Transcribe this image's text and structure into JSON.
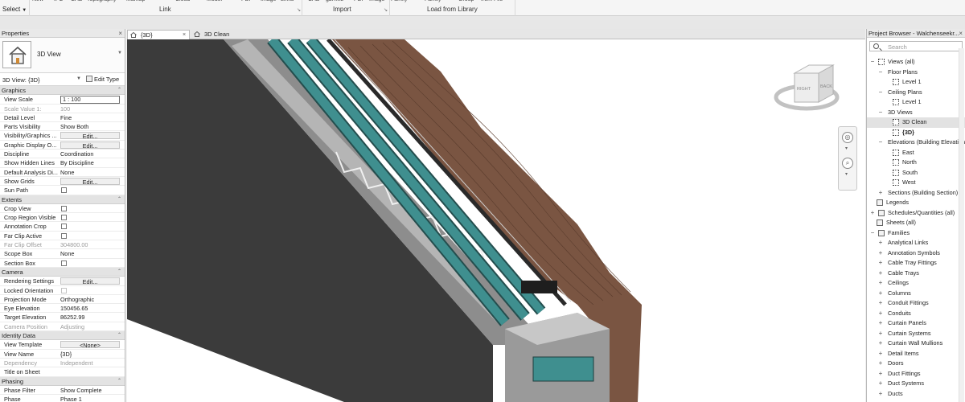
{
  "ribbon": {
    "cut_labels": [
      "New",
      "IFC",
      "CAD",
      "Topography",
      "Markup",
      "Cloud",
      "Model",
      "PDF",
      "Image",
      "Links",
      "CAD",
      "gbXML",
      "PDF",
      "Image",
      "Family",
      "Family",
      "Group",
      "from File"
    ],
    "select_label": "Select",
    "groups": {
      "link": "Link",
      "import": "Import",
      "load_from_library": "Load from Library"
    }
  },
  "properties": {
    "title": "Properties",
    "type_name": "3D View",
    "instance_selector": "3D View: {3D}",
    "edit_type": "Edit Type",
    "sections": [
      {
        "name": "Graphics",
        "rows": [
          {
            "k": "View Scale",
            "v": "1 : 100",
            "kind": "input"
          },
          {
            "k": "Scale Value    1:",
            "v": "100",
            "kind": "dis"
          },
          {
            "k": "Detail Level",
            "v": "Fine"
          },
          {
            "k": "Parts Visibility",
            "v": "Show Both"
          },
          {
            "k": "Visibility/Graphics ...",
            "v": "Edit...",
            "kind": "btn"
          },
          {
            "k": "Graphic Display O...",
            "v": "Edit...",
            "kind": "btn"
          },
          {
            "k": "Discipline",
            "v": "Coordination"
          },
          {
            "k": "Show Hidden Lines",
            "v": "By Discipline"
          },
          {
            "k": "Default Analysis Di...",
            "v": "None"
          },
          {
            "k": "Show Grids",
            "v": "Edit...",
            "kind": "btn"
          },
          {
            "k": "Sun Path",
            "v": "",
            "kind": "cb"
          }
        ]
      },
      {
        "name": "Extents",
        "rows": [
          {
            "k": "Crop View",
            "v": "",
            "kind": "cb"
          },
          {
            "k": "Crop Region Visible",
            "v": "",
            "kind": "cb"
          },
          {
            "k": "Annotation Crop",
            "v": "",
            "kind": "cb"
          },
          {
            "k": "Far Clip Active",
            "v": "",
            "kind": "cb"
          },
          {
            "k": "Far Clip Offset",
            "v": "304800.00",
            "kind": "dis"
          },
          {
            "k": "Scope Box",
            "v": "None"
          },
          {
            "k": "Section Box",
            "v": "",
            "kind": "cb"
          }
        ]
      },
      {
        "name": "Camera",
        "rows": [
          {
            "k": "Rendering Settings",
            "v": "Edit...",
            "kind": "btn"
          },
          {
            "k": "Locked Orientation",
            "v": "",
            "kind": "cbdis"
          },
          {
            "k": "Projection Mode",
            "v": "Orthographic"
          },
          {
            "k": "Eye Elevation",
            "v": "150456.65"
          },
          {
            "k": "Target Elevation",
            "v": "86252.99"
          },
          {
            "k": "Camera Position",
            "v": "Adjusting",
            "kind": "dis"
          }
        ]
      },
      {
        "name": "Identity Data",
        "rows": [
          {
            "k": "View Template",
            "v": "<None>",
            "kind": "btn"
          },
          {
            "k": "View Name",
            "v": "{3D}"
          },
          {
            "k": "Dependency",
            "v": "Independent",
            "kind": "dis"
          },
          {
            "k": "Title on Sheet",
            "v": ""
          }
        ]
      },
      {
        "name": "Phasing",
        "rows": [
          {
            "k": "Phase Filter",
            "v": "Show Complete"
          },
          {
            "k": "Phase",
            "v": "Phase 1"
          }
        ]
      }
    ]
  },
  "tabs": [
    {
      "label": "{3D}",
      "active": true
    },
    {
      "label": "3D Clean",
      "active": false
    }
  ],
  "viewcube": {
    "faces": [
      "RIGHT",
      "BACK"
    ]
  },
  "browser": {
    "title": "Project Browser - Walchenseekr...",
    "search_placeholder": "Search",
    "items": [
      {
        "label": "Views (all)",
        "level": 0,
        "exp": "−",
        "icon": "views"
      },
      {
        "label": "Floor Plans",
        "level": 1,
        "exp": "−"
      },
      {
        "label": "Level 1",
        "level": 2,
        "icon": "view"
      },
      {
        "label": "Ceiling Plans",
        "level": 1,
        "exp": "−"
      },
      {
        "label": "Level 1",
        "level": 2,
        "icon": "view"
      },
      {
        "label": "3D Views",
        "level": 1,
        "exp": "−"
      },
      {
        "label": "3D Clean",
        "level": 2,
        "icon": "view",
        "selected": true
      },
      {
        "label": "{3D}",
        "level": 2,
        "icon": "view",
        "bold": true
      },
      {
        "label": "Elevations (Building Elevation)",
        "level": 1,
        "exp": "−"
      },
      {
        "label": "East",
        "level": 2,
        "icon": "view"
      },
      {
        "label": "North",
        "level": 2,
        "icon": "view"
      },
      {
        "label": "South",
        "level": 2,
        "icon": "view"
      },
      {
        "label": "West",
        "level": 2,
        "icon": "view"
      },
      {
        "label": "Sections (Building Section)",
        "level": 1,
        "exp": "+"
      },
      {
        "label": "Legends",
        "level": 0,
        "icon": "solid"
      },
      {
        "label": "Schedules/Quantities (all)",
        "level": 0,
        "exp": "+",
        "icon": "solid"
      },
      {
        "label": "Sheets (all)",
        "level": 0,
        "icon": "solid"
      },
      {
        "label": "Families",
        "level": 0,
        "exp": "−",
        "icon": "solid"
      },
      {
        "label": "Analytical Links",
        "level": 1,
        "exp": "+"
      },
      {
        "label": "Annotation Symbols",
        "level": 1,
        "exp": "+"
      },
      {
        "label": "Cable Tray Fittings",
        "level": 1,
        "exp": "+"
      },
      {
        "label": "Cable Trays",
        "level": 1,
        "exp": "+"
      },
      {
        "label": "Ceilings",
        "level": 1,
        "exp": "+"
      },
      {
        "label": "Columns",
        "level": 1,
        "exp": "+"
      },
      {
        "label": "Conduit Fittings",
        "level": 1,
        "exp": "+"
      },
      {
        "label": "Conduits",
        "level": 1,
        "exp": "+"
      },
      {
        "label": "Curtain Panels",
        "level": 1,
        "exp": "+"
      },
      {
        "label": "Curtain Systems",
        "level": 1,
        "exp": "+"
      },
      {
        "label": "Curtain Wall Mullions",
        "level": 1,
        "exp": "+"
      },
      {
        "label": "Detail Items",
        "level": 1,
        "exp": "+"
      },
      {
        "label": "Doors",
        "level": 1,
        "exp": "+"
      },
      {
        "label": "Duct Fittings",
        "level": 1,
        "exp": "+"
      },
      {
        "label": "Duct Systems",
        "level": 1,
        "exp": "+"
      },
      {
        "label": "Ducts",
        "level": 1,
        "exp": "+"
      }
    ]
  },
  "colors": {
    "pipe": "#3f8f8f",
    "rock": "#7a5542",
    "slab": "#3b3b3b"
  }
}
